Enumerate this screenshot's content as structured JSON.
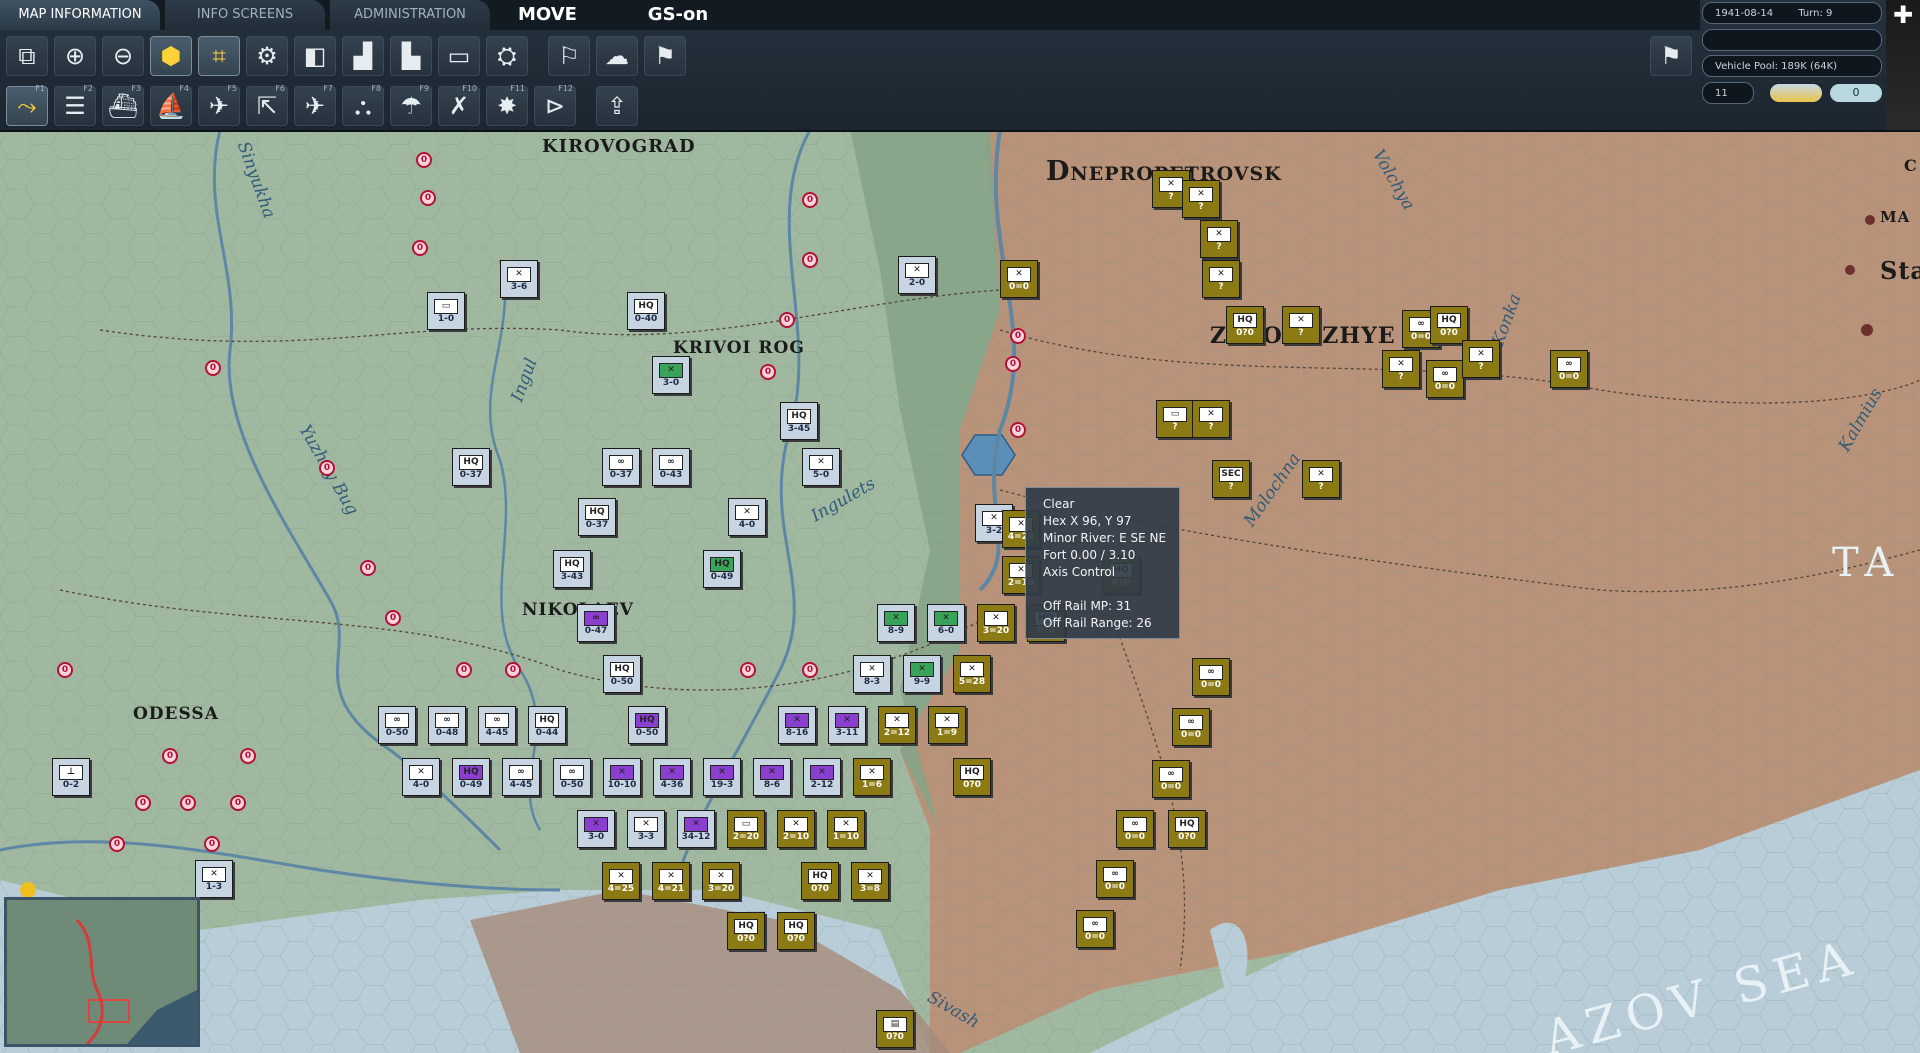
{
  "tabs": {
    "map_information": "MAP INFORMATION",
    "info_screens": "INFO SCREENS",
    "administration": "ADMINISTRATION",
    "move": "MOVE",
    "gs_on": "GS-on"
  },
  "function_keys": [
    "F1",
    "F2",
    "F3",
    "F4",
    "F5",
    "F6",
    "F7",
    "F8",
    "F9",
    "F10",
    "F11",
    "F12"
  ],
  "status": {
    "date": "1941-08-14",
    "turn": "Turn: 9",
    "vehicle_pool": "Vehicle Pool: 189K (64K)",
    "counter": "11",
    "zero_badge": "0"
  },
  "tooltip": {
    "terrain": "Clear",
    "hex": "Hex X 96, Y 97",
    "river": "Minor River: E SE NE",
    "fort": "Fort  0.00 / 3.10",
    "control": "Axis Control",
    "rail_mp": "Off Rail MP: 31",
    "rail_range": "Off Rail Range: 26"
  },
  "cities": {
    "kirovograd": "KIROVOGRAD",
    "dnepro": "Dnepropetrovsk",
    "zaporozhye": "ZAPOROZHYE",
    "krivoi_rog": "KRIVOI ROG",
    "nikolaev": "NIKOLAEV",
    "odessa": "ODESSA",
    "ma": "MA",
    "sta": "Sta",
    "c": "C"
  },
  "rivers": {
    "sinyukha": "Sinyukha",
    "ingul": "Ingul",
    "yuzhny_bug": "Yuzhny Bug",
    "ingulets": "Ingulets",
    "volchya": "Volchya",
    "molochna": "Molochna",
    "kalmius": "Kalmius",
    "konka": "Konka",
    "sivash": "Sivash"
  },
  "sea": {
    "azov": "AZOV SEA",
    "ta": "TA"
  },
  "units": [
    {
      "type": "sov",
      "str": "3-6",
      "sym": "✕"
    },
    {
      "type": "sov",
      "str": "1-0",
      "sym": "▭"
    },
    {
      "type": "sov",
      "str": "0-40",
      "sym": "HQ"
    },
    {
      "type": "sov",
      "str": "2-0",
      "sym": "✕"
    },
    {
      "type": "ax",
      "str": "0=0",
      "sym": "✕"
    },
    {
      "type": "grn",
      "str": "3-0",
      "sym": "✕"
    },
    {
      "type": "sov",
      "str": "3-45",
      "sym": "HQ"
    },
    {
      "type": "sov",
      "str": "0-37",
      "sym": "HQ"
    },
    {
      "type": "sov",
      "str": "0-37",
      "sym": "∞"
    },
    {
      "type": "sov",
      "str": "0-43",
      "sym": "∞"
    },
    {
      "type": "sov",
      "str": "5-0",
      "sym": "✕"
    },
    {
      "type": "sov",
      "str": "0-37",
      "sym": "HQ"
    },
    {
      "type": "sov",
      "str": "4-0",
      "sym": "✕"
    },
    {
      "type": "sov",
      "str": "3-43",
      "sym": "HQ"
    },
    {
      "type": "grn",
      "str": "0-49",
      "sym": "HQ"
    },
    {
      "type": "pur",
      "str": "0-47",
      "sym": "∞"
    },
    {
      "type": "sov",
      "str": "3-2",
      "sym": "✕"
    },
    {
      "type": "ax",
      "str": "4=24",
      "sym": "✕"
    },
    {
      "type": "ax",
      "str": "2=16",
      "sym": "✕"
    },
    {
      "type": "ax",
      "str": "0?0",
      "sym": "HQ"
    },
    {
      "type": "grn",
      "str": "8-9",
      "sym": "✕"
    },
    {
      "type": "grn",
      "str": "6-0",
      "sym": "✕"
    },
    {
      "type": "ax",
      "str": "3=20",
      "sym": "✕"
    },
    {
      "type": "ax",
      "str": "0?0",
      "sym": "HQ"
    },
    {
      "type": "sov",
      "str": "0-50",
      "sym": "HQ"
    },
    {
      "type": "sov",
      "str": "8-3",
      "sym": "✕"
    },
    {
      "type": "grn",
      "str": "9-9",
      "sym": "✕"
    },
    {
      "type": "ax",
      "str": "5=28",
      "sym": "✕"
    },
    {
      "type": "sov",
      "str": "0-50",
      "sym": "∞"
    },
    {
      "type": "sov",
      "str": "0-48",
      "sym": "∞"
    },
    {
      "type": "sov",
      "str": "4-45",
      "sym": "∞"
    },
    {
      "type": "sov",
      "str": "0-44",
      "sym": "HQ"
    },
    {
      "type": "pur",
      "str": "0-50",
      "sym": "HQ"
    },
    {
      "type": "pur",
      "str": "8-16",
      "sym": "✕"
    },
    {
      "type": "pur",
      "str": "3-11",
      "sym": "✕"
    },
    {
      "type": "ax",
      "str": "2=12",
      "sym": "✕"
    },
    {
      "type": "ax",
      "str": "1=9",
      "sym": "✕"
    },
    {
      "type": "sov",
      "str": "0-2",
      "sym": "⊥"
    },
    {
      "type": "sov",
      "str": "4-0",
      "sym": "✕"
    },
    {
      "type": "pur",
      "str": "0-49",
      "sym": "HQ"
    },
    {
      "type": "sov",
      "str": "4-45",
      "sym": "∞"
    },
    {
      "type": "sov",
      "str": "0-50",
      "sym": "∞"
    },
    {
      "type": "pur",
      "str": "10-10",
      "sym": "✕"
    },
    {
      "type": "pur",
      "str": "4-36",
      "sym": "✕"
    },
    {
      "type": "pur",
      "str": "19-3",
      "sym": "✕"
    },
    {
      "type": "pur",
      "str": "8-6",
      "sym": "✕"
    },
    {
      "type": "pur",
      "str": "2-12",
      "sym": "✕"
    },
    {
      "type": "ax",
      "str": "1=6",
      "sym": "✕"
    },
    {
      "type": "ax",
      "str": "0?0",
      "sym": "HQ"
    },
    {
      "type": "pur",
      "str": "3-0",
      "sym": "✕"
    },
    {
      "type": "sov",
      "str": "3-3",
      "sym": "✕"
    },
    {
      "type": "pur",
      "str": "34-12",
      "sym": "✕"
    },
    {
      "type": "ax",
      "str": "2=20",
      "sym": "▭"
    },
    {
      "type": "ax",
      "str": "2=10",
      "sym": "✕"
    },
    {
      "type": "ax",
      "str": "1=10",
      "sym": "✕"
    },
    {
      "type": "sov",
      "str": "1-3",
      "sym": "✕"
    },
    {
      "type": "ax",
      "str": "4=25",
      "sym": "✕"
    },
    {
      "type": "ax",
      "str": "4=21",
      "sym": "✕"
    },
    {
      "type": "ax",
      "str": "3=20",
      "sym": "✕"
    },
    {
      "type": "ax",
      "str": "0?0",
      "sym": "HQ"
    },
    {
      "type": "ax",
      "str": "3=8",
      "sym": "✕"
    },
    {
      "type": "ax",
      "str": "0?0",
      "sym": "HQ"
    },
    {
      "type": "ax",
      "str": "0?0",
      "sym": "HQ"
    },
    {
      "type": "ax",
      "str": "0?0",
      "sym": "HQ"
    },
    {
      "type": "ax",
      "str": "?",
      "sym": "✕"
    },
    {
      "type": "ax",
      "str": "?",
      "sym": "✕"
    },
    {
      "type": "ax",
      "str": "?",
      "sym": "✕"
    },
    {
      "type": "ax",
      "str": "?",
      "sym": "✕"
    },
    {
      "type": "ax",
      "str": "0?0",
      "sym": "HQ"
    },
    {
      "type": "ax",
      "str": "?",
      "sym": "✕"
    },
    {
      "type": "ax",
      "str": "?",
      "sym": "✕"
    },
    {
      "type": "ax",
      "str": "0=0",
      "sym": "∞"
    },
    {
      "type": "ax",
      "str": "0=0",
      "sym": "∞"
    },
    {
      "type": "ax",
      "str": "0?0",
      "sym": "HQ"
    },
    {
      "type": "ax",
      "str": "?",
      "sym": "✕"
    },
    {
      "type": "ax",
      "str": "0=0",
      "sym": "∞"
    },
    {
      "type": "ax",
      "str": "?",
      "sym": "▭"
    },
    {
      "type": "ax",
      "str": "?",
      "sym": "✕"
    },
    {
      "type": "ax",
      "str": "?",
      "sym": "SEC"
    },
    {
      "type": "ax",
      "str": "?",
      "sym": "✕"
    },
    {
      "type": "ax",
      "str": "0=0",
      "sym": "∞"
    },
    {
      "type": "ax",
      "str": "0=0",
      "sym": "∞"
    },
    {
      "type": "ax",
      "str": "0=0",
      "sym": "∞"
    },
    {
      "type": "ax",
      "str": "0=0",
      "sym": "∞"
    },
    {
      "type": "ax",
      "str": "0?0",
      "sym": "HQ"
    },
    {
      "type": "ax",
      "str": "0=0",
      "sym": "∞"
    },
    {
      "type": "ax",
      "str": "0=0",
      "sym": "∞"
    },
    {
      "type": "ax",
      "str": "0?0",
      "sym": "▤"
    }
  ],
  "colors": {
    "soviet_terrain": "#9fb89f",
    "axis_terrain": "#b89279",
    "sea": "#b9cdd8",
    "axis_unit": "#8c7a14",
    "soviet_unit": "#c7d5e2"
  }
}
